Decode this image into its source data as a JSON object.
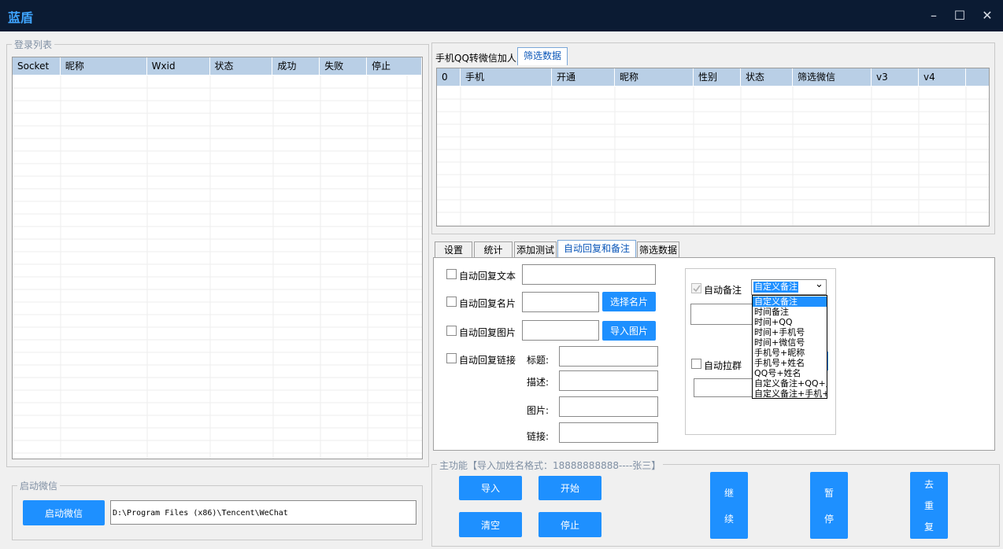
{
  "window": {
    "title": "蓝盾",
    "minimize": "–",
    "maximize": "☐",
    "close": "✕"
  },
  "login_list": {
    "legend": "登录列表",
    "columns": [
      "Socket",
      "昵称",
      "Wxid",
      "状态",
      "成功",
      "失败",
      "停止"
    ]
  },
  "start_wechat": {
    "legend": "启动微信",
    "button": "启动微信",
    "path": "D:\\Program Files (x86)\\Tencent\\WeChat"
  },
  "top_tabs": [
    "手机QQ转微信加人",
    "筛选数据"
  ],
  "filter_grid": {
    "columns": [
      "0",
      "手机",
      "开通",
      "昵称",
      "性别",
      "状态",
      "筛选微信",
      "v3",
      "v4"
    ]
  },
  "bottom_tabs": [
    "设置",
    "统计",
    "添加测试",
    "自动回复和备注",
    "筛选数据"
  ],
  "auto_reply": {
    "text_label": "自动回复文本",
    "card_label": "自动回复名片",
    "card_button": "选择名片",
    "image_label": "自动回复图片",
    "image_button": "导入图片",
    "link_label": "自动回复链接",
    "link_title": "标题:",
    "link_desc": "描述:",
    "link_image": "图片:",
    "link_url": "链接:"
  },
  "auto_remark": {
    "label": "自动备注",
    "selected": "自定义备注",
    "chevron": "⌄",
    "options": [
      "自定义备注",
      "时间备注",
      "时间+QQ",
      "时间+手机号",
      "时间+微信号",
      "手机号+昵称",
      "手机号+姓名",
      "QQ号+姓名",
      "自定义备注+QQ+月",
      "自定义备注+手机+"
    ],
    "group_label": "自动拉群"
  },
  "main_func": {
    "legend": "主功能【导入加姓名格式：18888888888----张三】",
    "import": "导入",
    "start": "开始",
    "clear": "清空",
    "stop": "停止",
    "continue_a": "继",
    "continue_b": "续",
    "pause_a": "暂",
    "pause_b": "停",
    "dedup_a": "去",
    "dedup_b": "重",
    "dedup_c": "复"
  }
}
